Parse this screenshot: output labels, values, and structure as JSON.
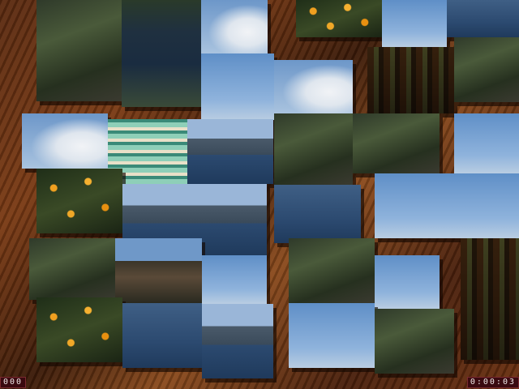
{
  "game": {
    "moves_display": "000",
    "timer_display": "0:00:03"
  },
  "pieces": [
    {
      "id": "p01",
      "theme": "hill"
    },
    {
      "id": "p02",
      "theme": "lake"
    },
    {
      "id": "p03",
      "theme": "cloud"
    },
    {
      "id": "p04",
      "theme": "flowers"
    },
    {
      "id": "p05",
      "theme": "sky"
    },
    {
      "id": "p06",
      "theme": "sea"
    },
    {
      "id": "p07",
      "theme": "village"
    },
    {
      "id": "p08",
      "theme": "sky"
    },
    {
      "id": "p09",
      "theme": "cloud"
    },
    {
      "id": "p10",
      "theme": "hill"
    },
    {
      "id": "p11",
      "theme": "cloud"
    },
    {
      "id": "p12",
      "theme": "greenvillage"
    },
    {
      "id": "p13",
      "theme": "coast"
    },
    {
      "id": "p14",
      "theme": "hill"
    },
    {
      "id": "p15",
      "theme": "hill"
    },
    {
      "id": "p16",
      "theme": "sky"
    },
    {
      "id": "p17",
      "theme": "flowers"
    },
    {
      "id": "p18",
      "theme": "coast"
    },
    {
      "id": "p19",
      "theme": "sea"
    },
    {
      "id": "p20",
      "theme": "sky"
    },
    {
      "id": "p21",
      "theme": "hill"
    },
    {
      "id": "p22",
      "theme": "tower"
    },
    {
      "id": "p23",
      "theme": "sky"
    },
    {
      "id": "p24",
      "theme": "hill"
    },
    {
      "id": "p25",
      "theme": "sky"
    },
    {
      "id": "p26",
      "theme": "village"
    },
    {
      "id": "p27",
      "theme": "flowers"
    },
    {
      "id": "p28",
      "theme": "sea"
    },
    {
      "id": "p29",
      "theme": "coast"
    },
    {
      "id": "p30",
      "theme": "sky"
    }
  ]
}
